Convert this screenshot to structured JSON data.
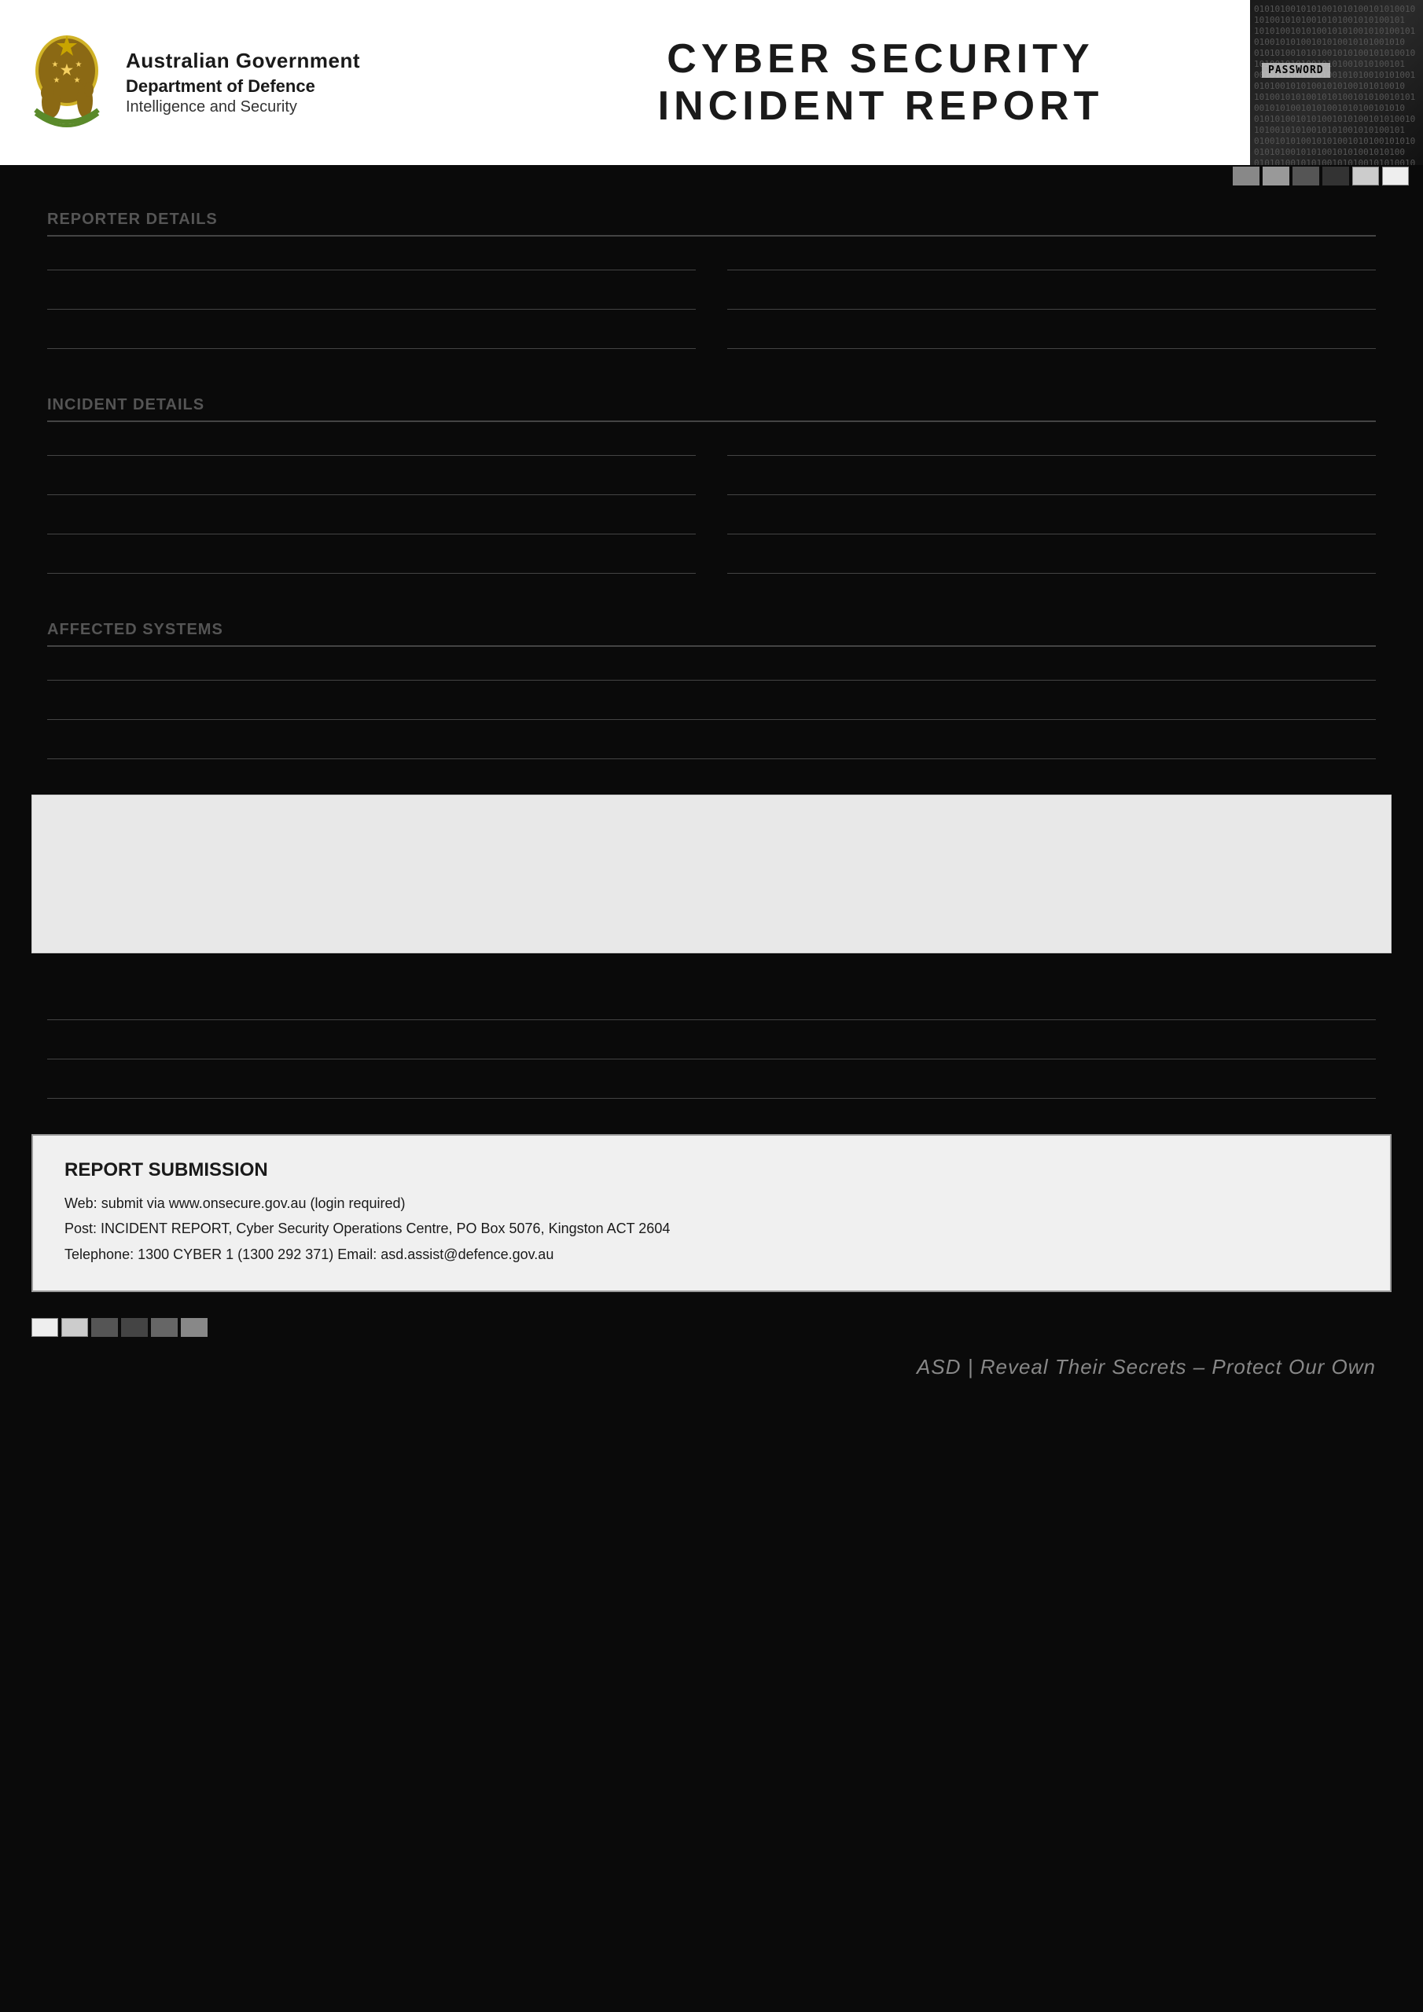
{
  "header": {
    "aus_gov_label": "Australian Government",
    "dept_label": "Department of Defence",
    "intel_label": "Intelligence and Security",
    "title_line1": "CYBER SECURITY",
    "title_line2": "INCIDENT REPORT"
  },
  "color_swatches_top": [
    {
      "color": "#888888"
    },
    {
      "color": "#999999"
    },
    {
      "color": "#555555"
    },
    {
      "color": "#333333"
    },
    {
      "color": "#cccccc"
    },
    {
      "color": "#eeeeee"
    }
  ],
  "color_swatches_bottom": [
    {
      "color": "#eeeeee"
    },
    {
      "color": "#cccccc"
    },
    {
      "color": "#555555"
    },
    {
      "color": "#444444"
    },
    {
      "color": "#666666"
    },
    {
      "color": "#888888"
    }
  ],
  "binary_text": "010101001010100101010010101001010100101010010101001010100101010010101001010100101010010101001010100101010010101001010100101010010101001010100101010010101001010100101010010101001010100101010010101001010100101010010101001010100101010010101001010100101010010101001010100101010010101001010100101010010101001010100101010010101001010100",
  "password_label": "PASSWORD",
  "form_sections": [
    {
      "id": "reporter_details",
      "label": "REPORTER DETAILS"
    },
    {
      "id": "incident_details",
      "label": "INCIDENT DETAILS"
    },
    {
      "id": "affected_systems",
      "label": "AFFECTED SYSTEMS"
    }
  ],
  "submission": {
    "title": "REPORT SUBMISSION",
    "web_line": "Web: submit via www.onsecure.gov.au (login required)",
    "post_line": "Post: INCIDENT REPORT, Cyber Security Operations Centre, PO Box 5076, Kingston ACT 2604",
    "phone_line": "Telephone: 1300 CYBER 1 (1300 292 371)  Email: asd.assist@defence.gov.au"
  },
  "footer": {
    "tagline": "ASD | Reveal Their Secrets – Protect Our Own"
  }
}
